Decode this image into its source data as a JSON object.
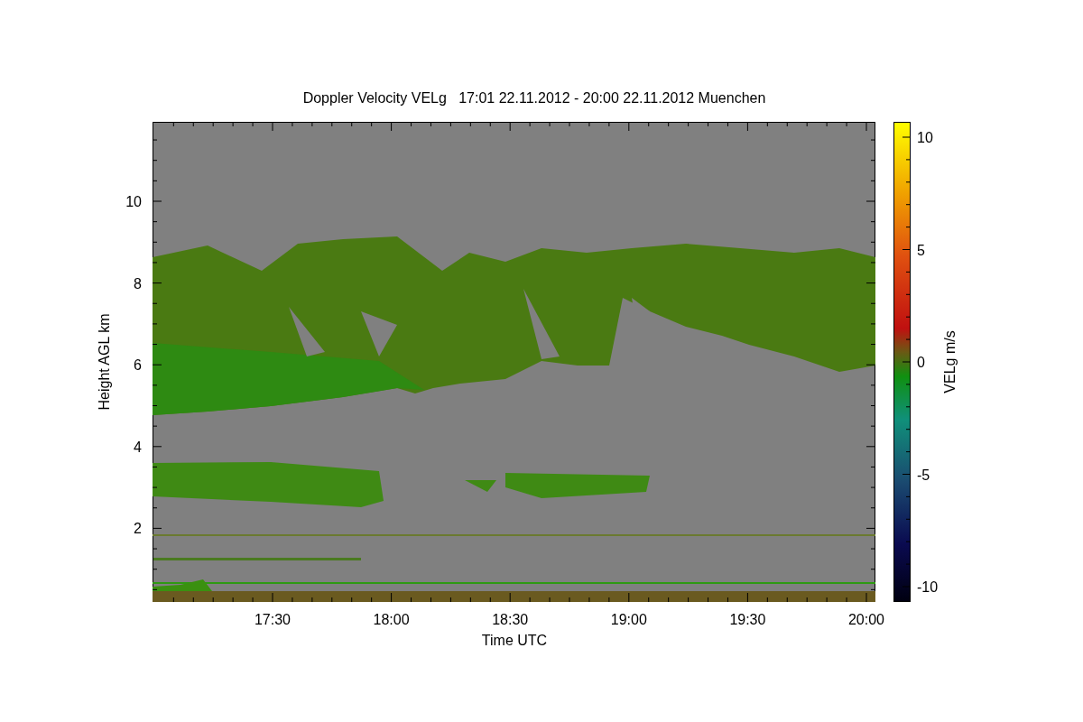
{
  "title": "Doppler Velocity VELg   17:01 22.11.2012 - 20:00 22.11.2012 Muenchen",
  "x_axis": {
    "label": "Time UTC",
    "ticks": [
      "17:30",
      "18:00",
      "18:30",
      "19:00",
      "19:30",
      "20:00"
    ]
  },
  "y_axis": {
    "label": "Height AGL km",
    "ticks": [
      "10",
      "8",
      "6",
      "4",
      "2"
    ]
  },
  "colorbar": {
    "label": "VELg m/s",
    "ticks": [
      "10",
      "5",
      "0",
      "-5",
      "-10"
    ]
  }
}
